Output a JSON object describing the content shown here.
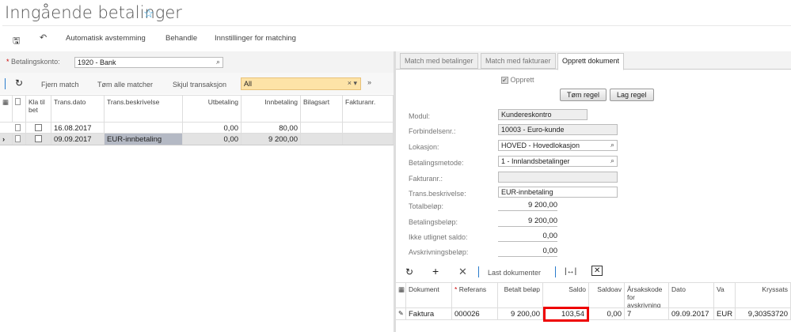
{
  "title": "Inngående betalinger",
  "toolbar": {
    "auto": "Automatisk avstemming",
    "process": "Behandle",
    "settings": "Innstillinger for matching"
  },
  "left": {
    "account_label": "Betalingskonto:",
    "account_value": "1920 - Bank",
    "actions": {
      "remove": "Fjern match",
      "clear_all": "Tøm alle matcher",
      "hide": "Skjul transaksjon"
    },
    "filter_value": "All",
    "columns": [
      "Kla til bet",
      "Trans.dato",
      "Trans.beskrivelse",
      "Utbetaling",
      "Innbetaling",
      "Bilagsart",
      "Fakturanr."
    ],
    "rows": [
      {
        "date": "16.08.2017",
        "desc": "",
        "out": "0,00",
        "in": "80,00"
      },
      {
        "date": "09.09.2017",
        "desc": "EUR-innbetaling",
        "out": "0,00",
        "in": "9 200,00"
      }
    ]
  },
  "right": {
    "tabs": [
      "Match med betalinger",
      "Match med fakturaer",
      "Opprett dokument"
    ],
    "create_label": "Opprett",
    "clear_rule": "Tøm regel",
    "make_rule": "Lag regel",
    "fields": {
      "module_label": "Modul:",
      "module": "Kundereskontro",
      "partner_label": "Forbindelsenr.:",
      "partner": "10003 - Euro-kunde",
      "location_label": "Lokasjon:",
      "location": "HOVED - Hovedlokasjon",
      "method_label": "Betalingsmetode:",
      "method": "1 - Innlandsbetalinger",
      "invoice_label": "Fakturanr.:",
      "invoice": "",
      "desc_label": "Trans.beskrivelse:",
      "desc": "EUR-innbetaling",
      "total_label": "Totalbeløp:",
      "total": "9 200,00",
      "payment_label": "Betalingsbeløp:",
      "payment": "9 200,00",
      "unapplied_label": "Ikke utlignet saldo:",
      "unapplied": "0,00",
      "writeoff_label": "Avskrivningsbeløp:",
      "writeoff": "0,00"
    },
    "grid_load": "Last dokumenter",
    "columns": [
      "Dokument",
      "Referans",
      "Betalt beløp",
      "Saldo",
      "Saldoav",
      "Årsakskode for avskrivning",
      "Dato",
      "Va",
      "Kryssats"
    ],
    "row": {
      "doc": "Faktura",
      "ref": "000026",
      "paid": "9 200,00",
      "balance": "103,54",
      "bal2": "0,00",
      "reason": "7",
      "date": "09.09.2017",
      "cur": "EUR",
      "rate": "9,30353720"
    }
  }
}
